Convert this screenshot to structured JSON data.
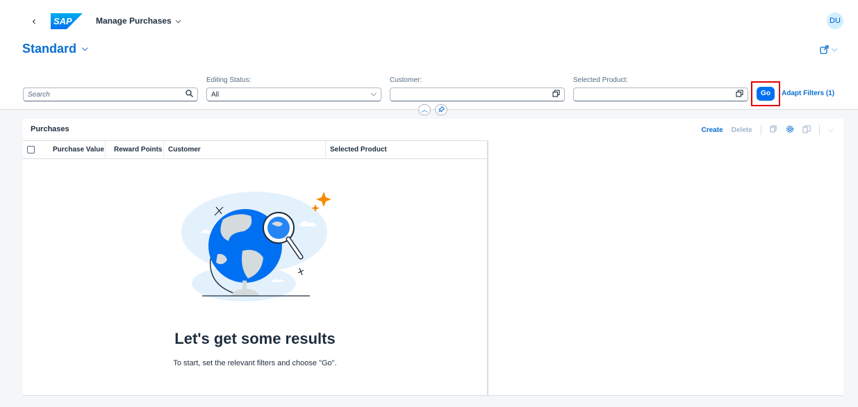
{
  "shell": {
    "back_icon": "chevron-left-icon",
    "logo_text": "SAP",
    "app_title": "Manage Purchases",
    "avatar_initials": "DU"
  },
  "variant": {
    "name": "Standard"
  },
  "filters": {
    "search": {
      "placeholder": "Search",
      "value": ""
    },
    "editing_status": {
      "label": "Editing Status:",
      "value": "All"
    },
    "customer": {
      "label": "Customer:",
      "value": ""
    },
    "selected_product": {
      "label": "Selected Product:",
      "value": ""
    },
    "go_label": "Go",
    "adapt_label": "Adapt Filters (1)"
  },
  "table": {
    "title": "Purchases",
    "create_label": "Create",
    "delete_label": "Delete",
    "columns": [
      "Purchase Value",
      "Reward Points",
      "Customer",
      "Selected Product"
    ]
  },
  "empty_state": {
    "title": "Let's get some results",
    "subtitle": "To start, set the relevant filters and choose \"Go\"."
  },
  "colors": {
    "brand": "#0070f2",
    "link": "#0a6ed1",
    "highlight": "#e00000"
  }
}
